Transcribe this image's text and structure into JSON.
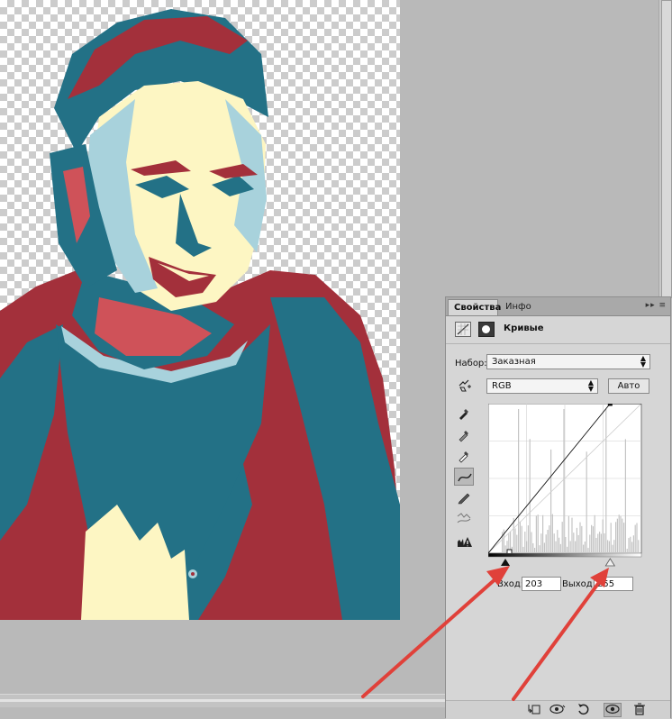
{
  "panel": {
    "tabs": [
      {
        "label": "Свойства",
        "active": true
      },
      {
        "label": "Инфо",
        "active": false
      }
    ],
    "menu_glyph": "▸▸ ≡",
    "adjustment_title": "Кривые",
    "preset_label": "Набор:",
    "preset_value": "Заказная",
    "channel_value": "RGB",
    "auto_button": "Авто",
    "input_label": "Вход:",
    "input_value": "203",
    "output_label": "Выход:",
    "output_value": "255"
  },
  "curve": {
    "points": [
      {
        "input": 0,
        "output": 0
      },
      {
        "input": 203,
        "output": 255
      },
      {
        "input": 255,
        "output": 255
      }
    ],
    "black_point_input": 0,
    "white_point_input": 203
  },
  "colors": {
    "panel_bg": "#d6d6d6",
    "arrow": "#e0413a",
    "poster_red": "#a3303b",
    "poster_teal": "#237186",
    "poster_cream": "#fdf6c3",
    "poster_lightblue": "#a8d2dc",
    "poster_coral": "#cf5259"
  },
  "icons": [
    "adjustment-layer-icon",
    "layer-mask-icon",
    "dropdown-arrows-icon",
    "on-image-adjust-icon",
    "black-eyedropper-icon",
    "gray-eyedropper-icon",
    "white-eyedropper-icon",
    "curve-edit-icon",
    "pencil-icon",
    "smooth-icon",
    "clipping-warning-icon",
    "clip-to-layer-icon",
    "view-previous-icon",
    "reset-icon",
    "visibility-eye-icon",
    "delete-icon"
  ]
}
